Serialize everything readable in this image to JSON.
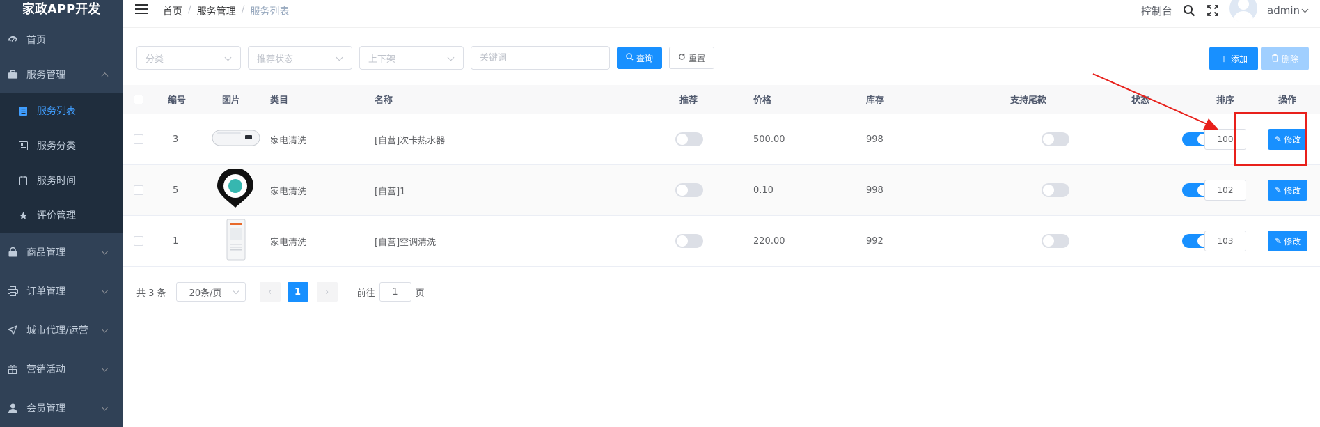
{
  "sidebar": {
    "logo": "家政APP开发",
    "items": [
      {
        "label": "首页",
        "icon": "dashboard-icon"
      },
      {
        "label": "服务管理",
        "icon": "briefcase-icon",
        "expanded": true,
        "children": [
          {
            "label": "服务列表",
            "icon": "list-icon",
            "active": true
          },
          {
            "label": "服务分类",
            "icon": "category-icon"
          },
          {
            "label": "服务时间",
            "icon": "clipboard-icon"
          },
          {
            "label": "评价管理",
            "icon": "star-icon"
          }
        ]
      },
      {
        "label": "商品管理",
        "icon": "lock-icon"
      },
      {
        "label": "订单管理",
        "icon": "printer-icon"
      },
      {
        "label": "城市代理/运营",
        "icon": "location-arrow-icon"
      },
      {
        "label": "营销活动",
        "icon": "gift-icon"
      },
      {
        "label": "会员管理",
        "icon": "user-icon"
      }
    ]
  },
  "navbar": {
    "breadcrumb": [
      "首页",
      "服务管理",
      "服务列表"
    ],
    "console": "控制台",
    "username": "admin"
  },
  "filters": {
    "category_placeholder": "分类",
    "recommend_placeholder": "推荐状态",
    "shelf_placeholder": "上下架",
    "keyword_placeholder": "关键词",
    "search_label": "查询",
    "reset_label": "重置"
  },
  "actions": {
    "add_label": "添加",
    "delete_label": "删除"
  },
  "table": {
    "headers": {
      "id": "编号",
      "image": "图片",
      "category": "类目",
      "name": "名称",
      "recommend": "推荐",
      "price": "价格",
      "stock": "库存",
      "tail": "支持尾款",
      "status": "状态",
      "sort": "排序",
      "ops": "操作"
    },
    "rows": [
      {
        "id": "3",
        "category": "家电清洗",
        "name": "[自营]次卡热水器",
        "recommend": false,
        "price": "500.00",
        "stock": "998",
        "tail": false,
        "status": true,
        "sort": "100",
        "edit": "修改"
      },
      {
        "id": "5",
        "category": "家电清洗",
        "name": "[自营]1",
        "recommend": false,
        "price": "0.10",
        "stock": "998",
        "tail": false,
        "status": true,
        "sort": "102",
        "edit": "修改"
      },
      {
        "id": "1",
        "category": "家电清洗",
        "name": "[自营]空调清洗",
        "recommend": false,
        "price": "220.00",
        "stock": "992",
        "tail": false,
        "status": true,
        "sort": "103",
        "edit": "修改"
      }
    ]
  },
  "pagination": {
    "total": "共 3 条",
    "page_size": "20条/页",
    "current": "1",
    "goto_prefix": "前往",
    "goto_value": "1",
    "goto_suffix": "页"
  },
  "colors": {
    "sidebar_bg": "#304156",
    "submenu_bg": "#1f2d3d",
    "primary": "#1890ff",
    "annotation": "#e8201b"
  }
}
